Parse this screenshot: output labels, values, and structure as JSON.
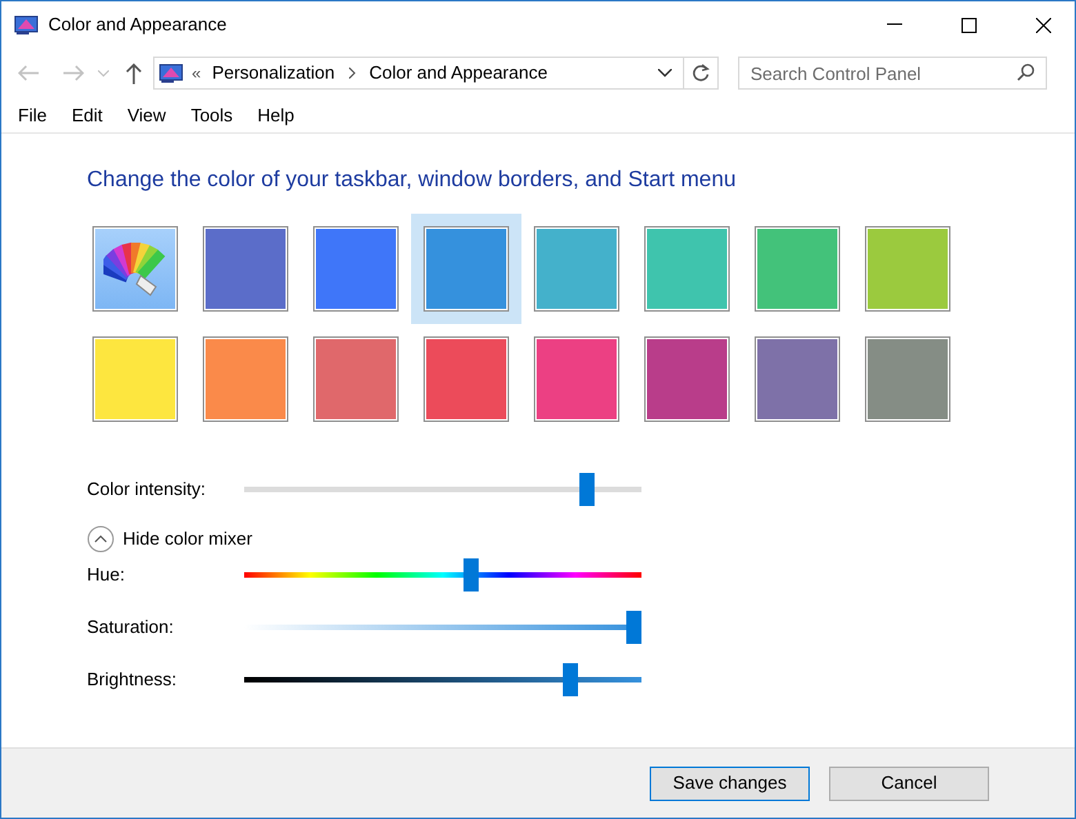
{
  "window": {
    "title": "Color and Appearance"
  },
  "address_bar": {
    "overflow": "«",
    "path": [
      "Personalization",
      "Color and Appearance"
    ]
  },
  "search": {
    "placeholder": "Search Control Panel"
  },
  "menu": [
    "File",
    "Edit",
    "View",
    "Tools",
    "Help"
  ],
  "heading": "Change the color of your taskbar, window borders, and Start menu",
  "swatches": [
    {
      "kind": "custom",
      "selected": false
    },
    {
      "kind": "color",
      "color": "#5b6dc9",
      "selected": false
    },
    {
      "kind": "color",
      "color": "#3f76f9",
      "selected": false
    },
    {
      "kind": "color",
      "color": "#3591dd",
      "selected": true
    },
    {
      "kind": "color",
      "color": "#44b1cb",
      "selected": false
    },
    {
      "kind": "color",
      "color": "#3fc4ad",
      "selected": false
    },
    {
      "kind": "color",
      "color": "#43c27a",
      "selected": false
    },
    {
      "kind": "color",
      "color": "#9bca3e",
      "selected": false
    },
    {
      "kind": "color",
      "color": "#fde63f",
      "selected": false
    },
    {
      "kind": "color",
      "color": "#fa8a4a",
      "selected": false
    },
    {
      "kind": "color",
      "color": "#e0686b",
      "selected": false
    },
    {
      "kind": "color",
      "color": "#ec4b5a",
      "selected": false
    },
    {
      "kind": "color",
      "color": "#ec4083",
      "selected": false
    },
    {
      "kind": "color",
      "color": "#b93d8a",
      "selected": false
    },
    {
      "kind": "color",
      "color": "#7e71a8",
      "selected": false
    },
    {
      "kind": "color",
      "color": "#858d85",
      "selected": false
    }
  ],
  "intensity": {
    "label": "Color intensity:",
    "kind": "plain",
    "level": 0.86
  },
  "mixer_toggle": {
    "label": "Hide color mixer",
    "expanded": true
  },
  "mixer": [
    {
      "label": "Hue:",
      "kind": "hue",
      "level": 0.57
    },
    {
      "label": "Saturation:",
      "kind": "saturation",
      "level": 0.98
    },
    {
      "label": "Brightness:",
      "kind": "brightness",
      "level": 0.82
    }
  ],
  "buttons": [
    "Save changes",
    "Cancel"
  ]
}
